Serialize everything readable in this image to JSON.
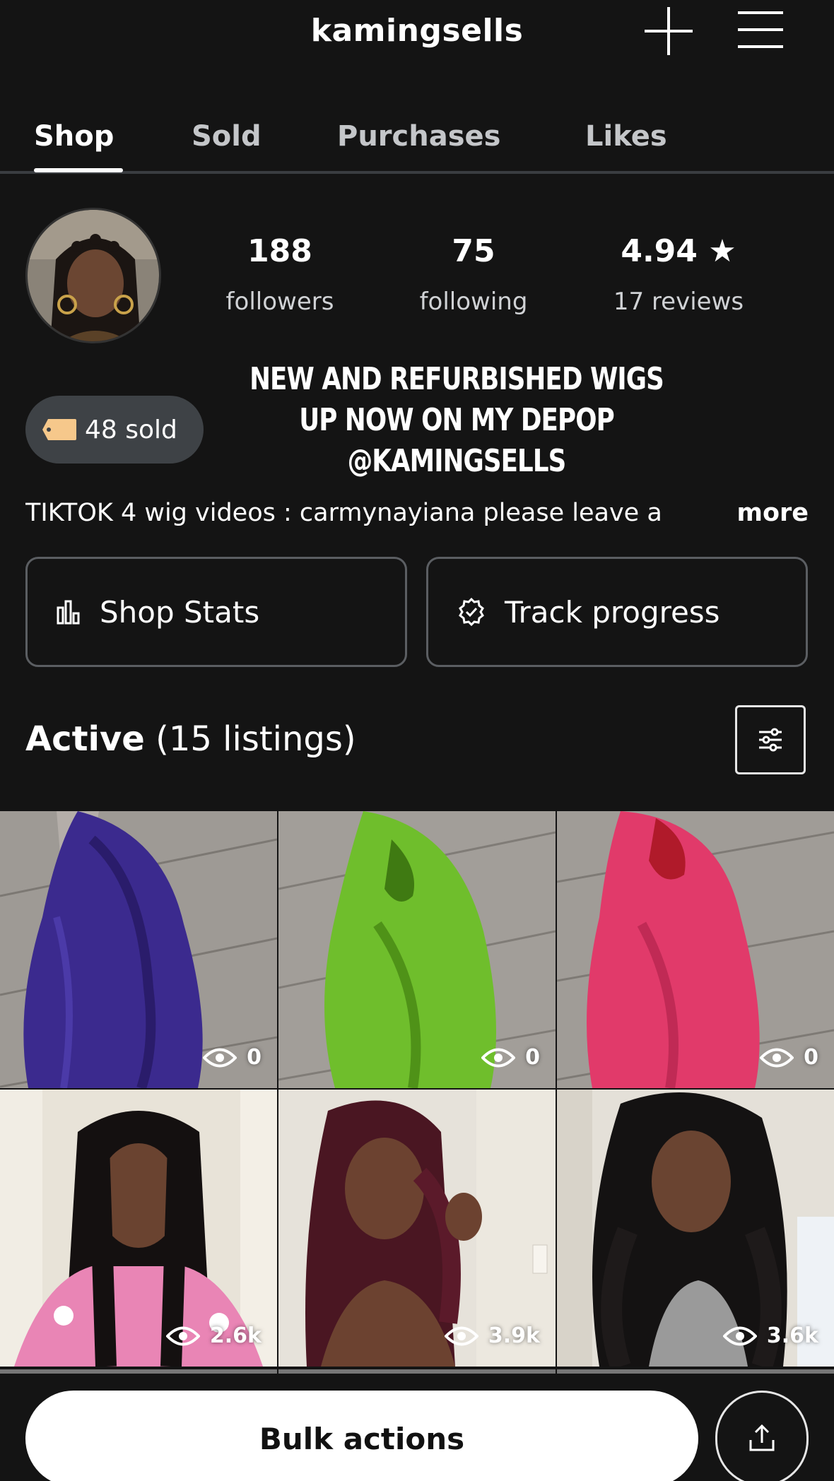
{
  "header": {
    "username": "kamingsells",
    "plus_icon": "plus-icon",
    "menu_icon": "hamburger-menu-icon"
  },
  "tabs": [
    {
      "label": "Shop",
      "active": true
    },
    {
      "label": "Sold",
      "active": false
    },
    {
      "label": "Purchases",
      "active": false
    },
    {
      "label": "Likes",
      "active": false
    }
  ],
  "profile": {
    "followers_count": "188",
    "followers_label": "followers",
    "following_count": "75",
    "following_label": "following",
    "rating": "4.94 ★",
    "reviews_label": "17 reviews",
    "sold_badge": "48 sold",
    "promo_line1": "NEW AND REFURBISHED WIGS",
    "promo_line2": "UP NOW ON MY DEPOP",
    "promo_line3": "@KAMINGSELLS",
    "bio": "TIKTOK 4 wig videos : carmynayiana please leave a",
    "bio_more": "more"
  },
  "actions": {
    "shop_stats": "Shop Stats",
    "track_progress": "Track progress"
  },
  "listings": {
    "title_bold": "Active",
    "title_count": "(15 listings)",
    "items": [
      {
        "views": "0",
        "desc": "purple wig"
      },
      {
        "views": "0",
        "desc": "green wig"
      },
      {
        "views": "0",
        "desc": "pink wig"
      },
      {
        "views": "2.6k",
        "desc": "black straight wig"
      },
      {
        "views": "3.9k",
        "desc": "burgundy wavy wig"
      },
      {
        "views": "3.6k",
        "desc": "black body wave wig"
      }
    ]
  },
  "bottom": {
    "bulk_actions": "Bulk actions",
    "share_icon": "share-upload-icon"
  },
  "colors": {
    "background": "#141414",
    "pill": "#3e4246",
    "border": "#5b5e62"
  }
}
